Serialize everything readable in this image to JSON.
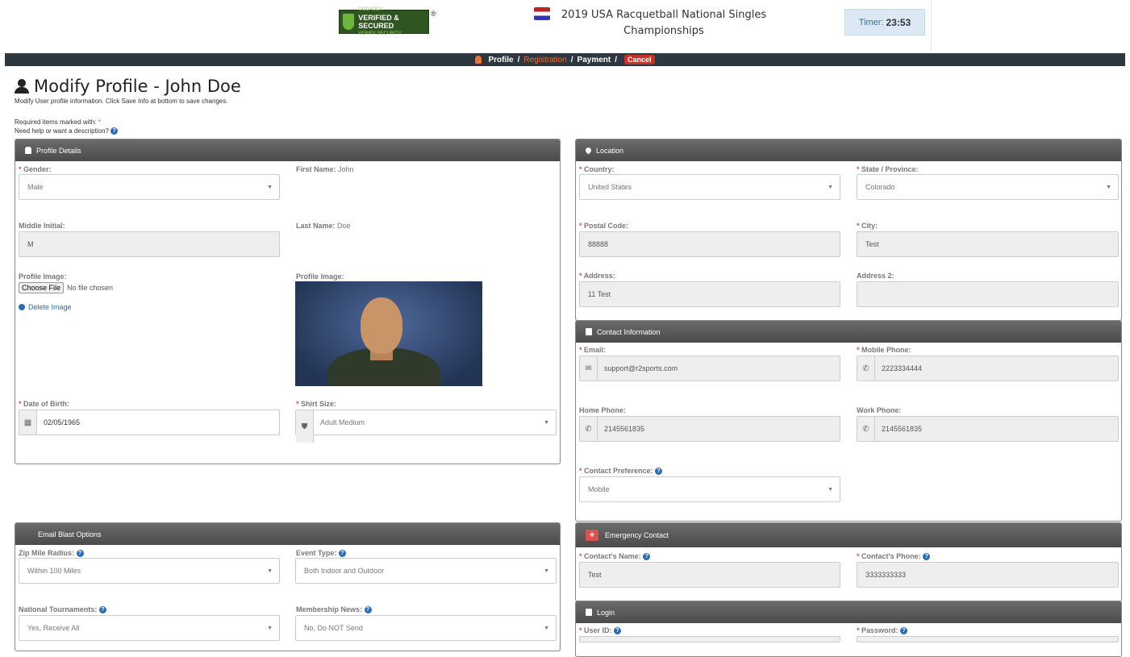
{
  "header": {
    "badge_title": "VERIFIED & SECURED",
    "badge_brand": "GODADDY",
    "badge_sub": "VERIFY SECURITY",
    "badge_reg": "®",
    "event_title": "2019 USA Racquetball National Singles Championships",
    "timer_label": "Timer:",
    "timer_value": "23:53"
  },
  "nav": {
    "profile": "Profile",
    "registration": "Registration",
    "payment": "Payment",
    "cancel": "Cancel",
    "sep": "/"
  },
  "page": {
    "title": "Modify Profile - John Doe",
    "subtitle": "Modify User profile information. Click Save Info at bottom to save changes.",
    "required_note": "Required items marked with:",
    "help_note": "Need help or want a description?"
  },
  "profile": {
    "panel_title": "Profile Details",
    "gender_label": "Gender:",
    "gender_value": "Male",
    "first_name_label": "First Name:",
    "first_name_value": "John",
    "middle_label": "Middle Initial:",
    "middle_value": "M",
    "last_name_label": "Last Name:",
    "last_name_value": "Doe",
    "image_label": "Profile Image:",
    "image_label2": "Profile Image:",
    "choose_file": "Choose File",
    "no_file": "No file chosen",
    "delete_image": "Delete Image",
    "dob_label": "Date of Birth:",
    "dob_value": "02/05/1965",
    "shirt_label": "Shirt Size:",
    "shirt_value": "Adult Medium"
  },
  "email_blast": {
    "panel_title": "Email Blast Options",
    "zip_label": "Zip Mile Radius:",
    "zip_value": "Within 100 Miles",
    "event_type_label": "Event Type:",
    "event_type_value": "Both Indoor and Outdoor",
    "national_label": "National Tournaments:",
    "national_value": "Yes, Receive All",
    "membership_label": "Membership News:",
    "membership_value": "No, Do NOT Send"
  },
  "location": {
    "panel_title": "Location",
    "country_label": "Country:",
    "country_value": "United States",
    "state_label": "State / Province:",
    "state_value": "Colorado",
    "postal_label": "Postal Code:",
    "postal_value": "88888",
    "city_label": "City:",
    "city_value": "Test",
    "address_label": "Address:",
    "address_value": "11 Test",
    "address2_label": "Address 2:",
    "address2_value": ""
  },
  "contact": {
    "panel_title": "Contact Information",
    "email_label": "Email:",
    "email_value": "support@r2sports.com",
    "mobile_label": "Mobile Phone:",
    "mobile_value": "2223334444",
    "home_label": "Home Phone:",
    "home_value": "2145561835",
    "work_label": "Work Phone:",
    "work_value": "2145561835",
    "pref_label": "Contact Preference:",
    "pref_value": "Mobile"
  },
  "emergency": {
    "panel_title": "Emergency Contact",
    "name_label": "Contact's Name:",
    "name_value": "Test",
    "phone_label": "Contact's Phone:",
    "phone_value": "3333333333"
  },
  "login": {
    "panel_title": "Login",
    "userid_label": "User ID:",
    "password_label": "Password:"
  },
  "colors": {
    "accent": "#e8743b",
    "link": "#2a6db5",
    "required": "#d9534f",
    "navbar": "#2e3640"
  }
}
